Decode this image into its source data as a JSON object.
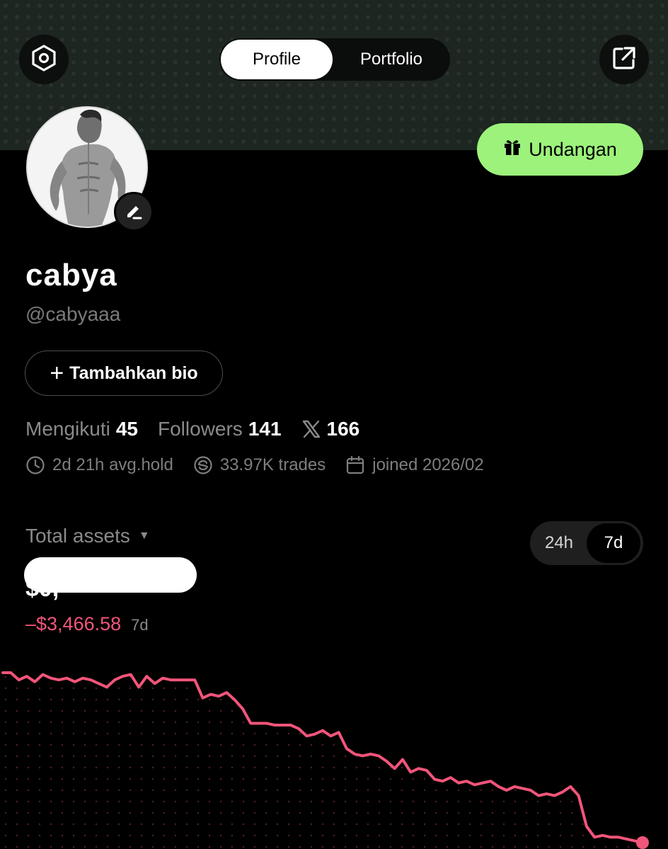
{
  "header": {
    "tabs": [
      {
        "label": "Profile",
        "active": true
      },
      {
        "label": "Portfolio",
        "active": false
      }
    ],
    "left_icon": "settings-hexagon-icon",
    "right_icon": "share-external-icon"
  },
  "invite_button": {
    "label": "Undangan",
    "icon": "gift-icon",
    "color": "#9cf27a"
  },
  "profile": {
    "display_name": "cabya",
    "handle": "@cabyaaa",
    "bio_button": "Tambahkan bio",
    "avatar_icon": "edit-pencil-icon"
  },
  "stats": {
    "following_label": "Mengikuti",
    "following_value": "45",
    "followers_label": "Followers",
    "followers_value": "141",
    "x_value": "166"
  },
  "meta": {
    "avg_hold": "2d 21h avg.hold",
    "trades": "33.97K trades",
    "joined": "joined 2026/02"
  },
  "assets": {
    "label": "Total assets",
    "value_hidden": "$0,",
    "change": "–$3,466.58",
    "change_period": "7d",
    "range_options": [
      "24h",
      "7d"
    ],
    "selected_range": "7d",
    "change_color": "#f2557a"
  },
  "chart_data": {
    "type": "line",
    "series": [
      {
        "values": [
          100,
          100,
          96,
          98,
          95,
          99,
          97,
          96,
          97,
          95,
          97,
          96,
          94,
          92,
          96,
          98,
          99,
          92,
          98,
          94,
          97,
          96,
          96,
          96,
          96,
          86,
          88,
          87,
          89,
          85,
          80,
          72,
          72,
          72,
          71,
          71,
          71,
          69,
          65,
          66,
          68,
          65,
          67,
          58,
          55,
          54,
          55,
          54,
          51,
          47,
          52,
          45,
          47,
          46,
          41,
          40,
          42,
          39,
          40,
          38,
          39,
          40,
          37,
          35,
          37,
          36,
          35,
          32,
          33,
          32,
          34,
          37,
          32,
          15,
          9,
          10,
          9,
          9,
          8,
          7,
          6
        ]
      }
    ]
  }
}
